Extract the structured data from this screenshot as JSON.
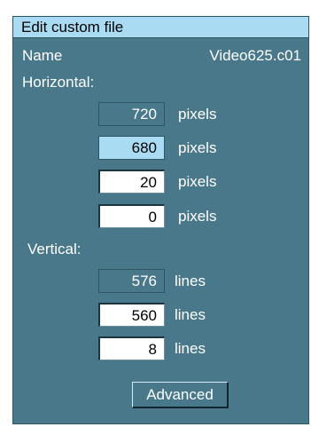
{
  "dialog": {
    "title": "Edit custom file",
    "name_label": "Name",
    "name_value": "Video625.c01"
  },
  "horizontal": {
    "label": "Horizontal:",
    "fields": [
      {
        "value": "720",
        "unit": "pixels",
        "state": "readonly"
      },
      {
        "value": "680",
        "unit": "pixels",
        "state": "selected"
      },
      {
        "value": "20",
        "unit": "pixels",
        "state": "editable"
      },
      {
        "value": "0",
        "unit": "pixels",
        "state": "editable"
      }
    ]
  },
  "vertical": {
    "label": "Vertical:",
    "fields": [
      {
        "value": "576",
        "unit": "lines",
        "state": "readonly"
      },
      {
        "value": "560",
        "unit": "lines",
        "state": "editable"
      },
      {
        "value": "8",
        "unit": "lines",
        "state": "editable"
      }
    ]
  },
  "actions": {
    "advanced_label": "Advanced"
  },
  "colors": {
    "panel_background": "#48788a",
    "titlebar_background": "#a9dbf3",
    "selected_field": "#a9dbf3",
    "text": "#ffffff"
  }
}
